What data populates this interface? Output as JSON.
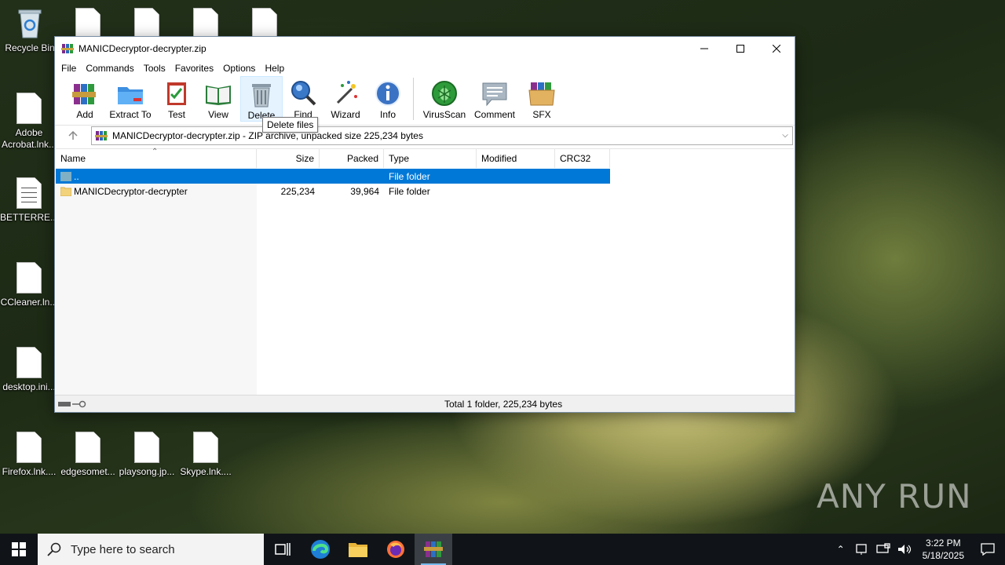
{
  "desktop": {
    "icons": [
      {
        "label": "Recycle Bin",
        "icon": "recycle-bin-icon"
      },
      {
        "label": "Adobe Acrobat.lnk...",
        "icon": "file-icon"
      },
      {
        "label": "BETTERRE...",
        "icon": "text-file-icon"
      },
      {
        "label": "CCleaner.ln...",
        "icon": "file-icon"
      },
      {
        "label": "desktop.ini...",
        "icon": "file-icon"
      },
      {
        "label": "Firefox.lnk....",
        "icon": "file-icon"
      },
      {
        "label": "edgesomet...",
        "icon": "file-icon"
      },
      {
        "label": "playsong.jp...",
        "icon": "file-icon"
      },
      {
        "label": "Skype.lnk....",
        "icon": "file-icon"
      }
    ]
  },
  "window": {
    "title": "MANICDecryptor-decrypter.zip",
    "menu": [
      "File",
      "Commands",
      "Tools",
      "Favorites",
      "Options",
      "Help"
    ],
    "toolbar": [
      {
        "label": "Add",
        "icon": "add-archive-icon"
      },
      {
        "label": "Extract To",
        "icon": "extract-folder-icon"
      },
      {
        "label": "Test",
        "icon": "test-clipboard-icon"
      },
      {
        "label": "View",
        "icon": "view-book-icon"
      },
      {
        "label": "Delete",
        "icon": "trash-icon"
      },
      {
        "label": "Find",
        "icon": "magnifier-icon"
      },
      {
        "label": "Wizard",
        "icon": "magic-wand-icon"
      },
      {
        "label": "Info",
        "icon": "info-icon"
      },
      {
        "label": "VirusScan",
        "icon": "virus-scan-icon"
      },
      {
        "label": "Comment",
        "icon": "comment-icon"
      },
      {
        "label": "SFX",
        "icon": "sfx-box-icon"
      }
    ],
    "tooltip": "Delete files",
    "address": "MANICDecryptor-decrypter.zip - ZIP archive, unpacked size 225,234 bytes",
    "columns": [
      "Name",
      "Size",
      "Packed",
      "Type",
      "Modified",
      "CRC32"
    ],
    "rows": [
      {
        "name": "..",
        "size": "",
        "packed": "",
        "type": "File folder",
        "modified": "",
        "crc": "",
        "selected": true
      },
      {
        "name": "MANICDecryptor-decrypter",
        "size": "225,234",
        "packed": "39,964",
        "type": "File folder",
        "modified": "",
        "crc": "",
        "selected": false
      }
    ],
    "status": "Total 1 folder, 225,234 bytes"
  },
  "taskbar": {
    "search_placeholder": "Type here to search",
    "time": "3:22 PM",
    "date": "5/18/2025",
    "apps": [
      "task-view-icon",
      "edge-icon",
      "file-explorer-icon",
      "firefox-icon",
      "winrar-icon"
    ]
  },
  "watermark": "ANY RUN"
}
